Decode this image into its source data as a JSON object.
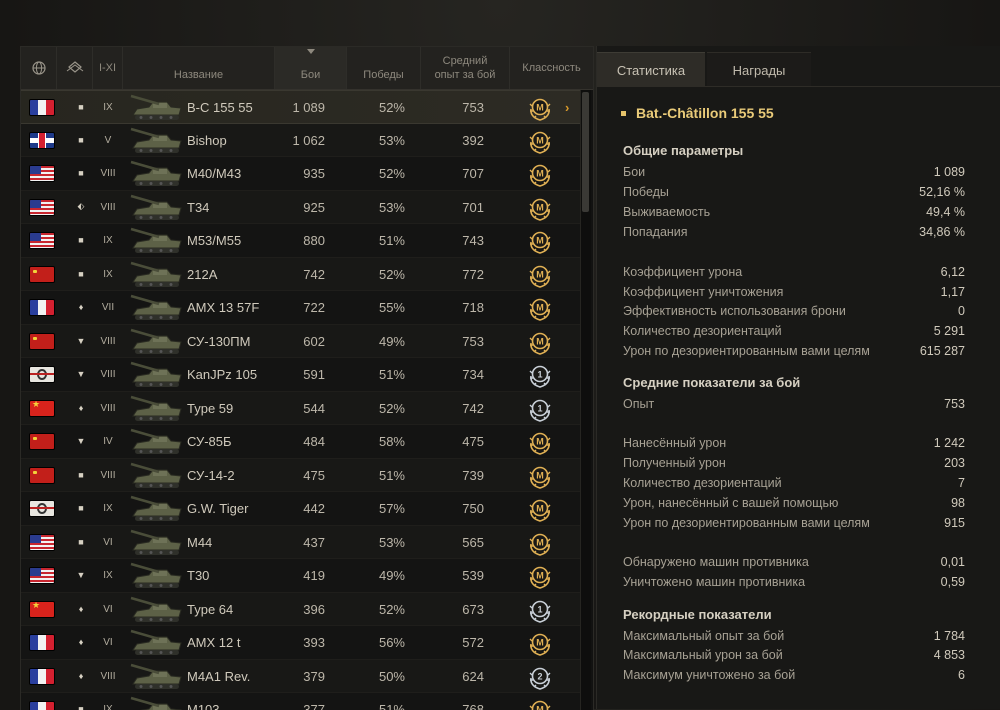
{
  "table": {
    "headers": {
      "nation": "",
      "type": "",
      "tier": "I-XI",
      "name": "Название",
      "battles": "Бои",
      "wins": "Победы",
      "avg_xp_line1": "Средний",
      "avg_xp_line2": "опыт за бой",
      "mastery": "Классность"
    },
    "rows": [
      {
        "nation": "fr",
        "type": "square",
        "tier": "IX",
        "name": "B-C 155 55",
        "battles": "1 089",
        "wins": "52%",
        "xp": "753",
        "badge": "M",
        "selected": true
      },
      {
        "nation": "uk",
        "type": "square",
        "tier": "V",
        "name": "Bishop",
        "battles": "1 062",
        "wins": "53%",
        "xp": "392",
        "badge": "M"
      },
      {
        "nation": "us",
        "type": "square",
        "tier": "VIII",
        "name": "M40/M43",
        "battles": "935",
        "wins": "52%",
        "xp": "707",
        "badge": "M"
      },
      {
        "nation": "us",
        "type": "chevrons",
        "tier": "VIII",
        "name": "T34",
        "battles": "925",
        "wins": "53%",
        "xp": "701",
        "badge": "M"
      },
      {
        "nation": "us",
        "type": "square",
        "tier": "IX",
        "name": "M53/M55",
        "battles": "880",
        "wins": "51%",
        "xp": "743",
        "badge": "M"
      },
      {
        "nation": "su",
        "type": "square",
        "tier": "IX",
        "name": "212A",
        "battles": "742",
        "wins": "52%",
        "xp": "772",
        "badge": "M"
      },
      {
        "nation": "fr",
        "type": "diamond",
        "tier": "VII",
        "name": "AMX 13 57F",
        "battles": "722",
        "wins": "55%",
        "xp": "718",
        "badge": "M"
      },
      {
        "nation": "su",
        "type": "triangle",
        "tier": "VIII",
        "name": "СУ-130ПМ",
        "battles": "602",
        "wins": "49%",
        "xp": "753",
        "badge": "M"
      },
      {
        "nation": "de",
        "type": "triangle",
        "tier": "VIII",
        "name": "KanJPz 105",
        "battles": "591",
        "wins": "51%",
        "xp": "734",
        "badge": "1"
      },
      {
        "nation": "cn",
        "type": "diamond",
        "tier": "VIII",
        "name": "Type 59",
        "battles": "544",
        "wins": "52%",
        "xp": "742",
        "badge": "1"
      },
      {
        "nation": "su",
        "type": "triangle",
        "tier": "IV",
        "name": "СУ-85Б",
        "battles": "484",
        "wins": "58%",
        "xp": "475",
        "badge": "M"
      },
      {
        "nation": "su",
        "type": "square",
        "tier": "VIII",
        "name": "СУ-14-2",
        "battles": "475",
        "wins": "51%",
        "xp": "739",
        "badge": "M"
      },
      {
        "nation": "de",
        "type": "square",
        "tier": "IX",
        "name": "G.W. Tiger",
        "battles": "442",
        "wins": "57%",
        "xp": "750",
        "badge": "M"
      },
      {
        "nation": "us",
        "type": "square",
        "tier": "VI",
        "name": "M44",
        "battles": "437",
        "wins": "53%",
        "xp": "565",
        "badge": "M"
      },
      {
        "nation": "us",
        "type": "triangle",
        "tier": "IX",
        "name": "T30",
        "battles": "419",
        "wins": "49%",
        "xp": "539",
        "badge": "M"
      },
      {
        "nation": "cn",
        "type": "diamond",
        "tier": "VI",
        "name": "Type 64",
        "battles": "396",
        "wins": "52%",
        "xp": "673",
        "badge": "1"
      },
      {
        "nation": "fr",
        "type": "diamond",
        "tier": "VI",
        "name": "AMX 12 t",
        "battles": "393",
        "wins": "56%",
        "xp": "572",
        "badge": "M"
      },
      {
        "nation": "fr",
        "type": "diamond",
        "tier": "VIII",
        "name": "M4A1 Rev.",
        "battles": "379",
        "wins": "50%",
        "xp": "624",
        "badge": "2"
      },
      {
        "nation": "fr",
        "type": "square",
        "tier": "IX",
        "name": "M103",
        "battles": "377",
        "wins": "51%",
        "xp": "768",
        "badge": "M"
      }
    ]
  },
  "tabs": {
    "stats": "Статистика",
    "awards": "Награды"
  },
  "details": {
    "title": "Bat.-Châtillon 155 55",
    "sections": {
      "general": {
        "heading": "Общие параметры",
        "rows": [
          {
            "label": "Бои",
            "value": "1 089"
          },
          {
            "label": "Победы",
            "value": "52,16 %"
          },
          {
            "label": "Выживаемость",
            "value": "49,4 %"
          },
          {
            "label": "Попадания",
            "value": "34,86 %"
          },
          {
            "label": "Коэффициент урона",
            "value": "6,12"
          },
          {
            "label": "Коэффициент уничтожения",
            "value": "1,17"
          },
          {
            "label": "Эффективность использования брони",
            "value": "0"
          },
          {
            "label": "Количество дезориентаций",
            "value": "5 291"
          },
          {
            "label": "Урон по дезориентированным вами целям",
            "value": "615 287"
          }
        ]
      },
      "average": {
        "heading": "Средние показатели за бой",
        "rows": [
          {
            "label": "Опыт",
            "value": "753"
          },
          {
            "label": "Нанесённый урон",
            "value": "1 242"
          },
          {
            "label": "Полученный урон",
            "value": "203"
          },
          {
            "label": "Количество дезориентаций",
            "value": "7"
          },
          {
            "label": "Урон, нанесённый с вашей помощью",
            "value": "98"
          },
          {
            "label": "Урон по дезориентированным вами целям",
            "value": "915"
          },
          {
            "label": "Обнаружено машин противника",
            "value": "0,01"
          },
          {
            "label": "Уничтожено машин противника",
            "value": "0,59"
          }
        ]
      },
      "records": {
        "heading": "Рекордные показатели",
        "rows": [
          {
            "label": "Максимальный опыт за бой",
            "value": "1 784"
          },
          {
            "label": "Максимальный урон за бой",
            "value": "4 853"
          },
          {
            "label": "Максимум уничтожено за бой",
            "value": "6"
          }
        ]
      }
    }
  },
  "colors": {
    "accent_gold": "#eacb79",
    "arrow_orange": "#d89a2b",
    "badge_gold": "#e0b054",
    "badge_silver": "#c9d0d8"
  }
}
